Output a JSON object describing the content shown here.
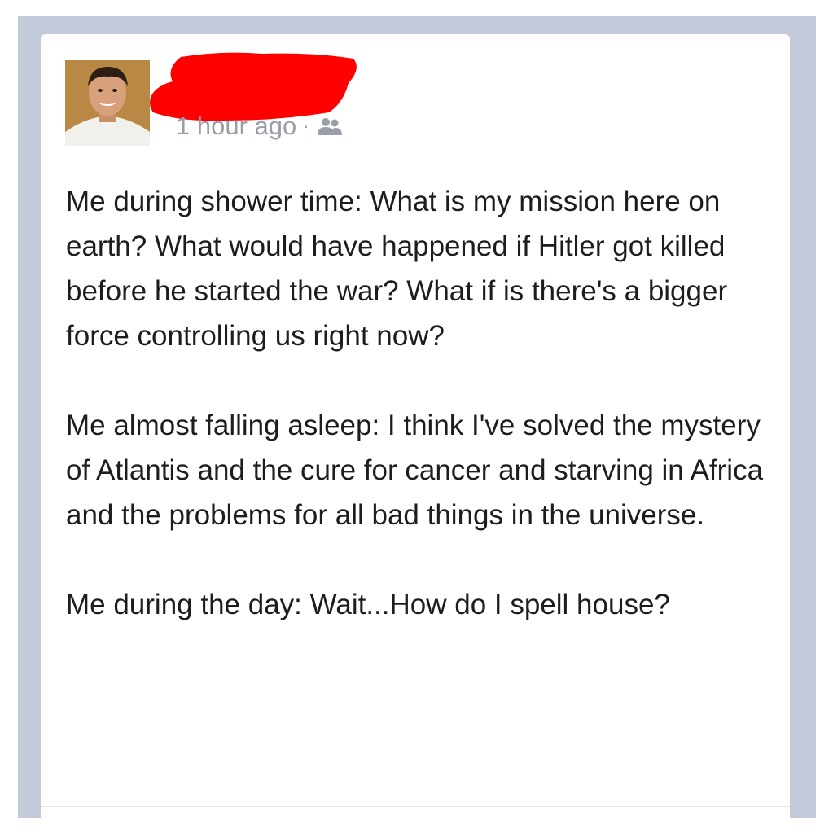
{
  "post": {
    "timestamp": "1 hour ago",
    "separator": "·",
    "audience_icon": "friends-icon",
    "author_name_redacted": true,
    "paragraphs": [
      "Me during shower time: What is my mission here on earth? What would have happened if Hitler got killed before he started the war? What if is there's a bigger force controlling us right now?",
      "Me almost falling asleep: I think I've solved the mystery of Atlantis and the cure for cancer and starving in Africa and the problems for all bad things in the universe.",
      "Me during the day: Wait...How do I spell house?"
    ]
  },
  "colors": {
    "background_frame": "#c3cad9",
    "card": "#ffffff",
    "redaction": "#ff0000",
    "meta_text": "#9a9ea6",
    "body_text": "#1d1d1d"
  }
}
